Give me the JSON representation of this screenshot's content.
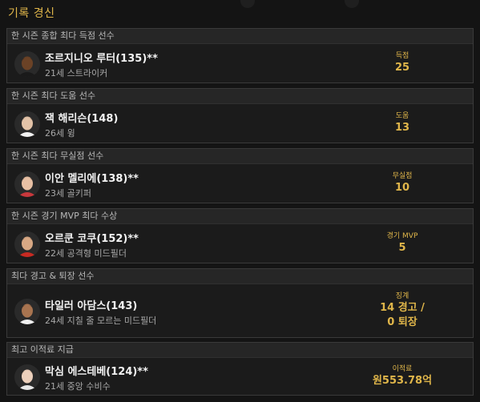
{
  "page_title": "기록 경신",
  "records": [
    {
      "category": "한 시즌 종합 최다 득점 선수",
      "name": "조르지니오 루터(135)**",
      "info": "21세 스트라이커",
      "stat_label": "득점",
      "stat_value": "25",
      "icon": "player-photo",
      "skin": "#6b4226",
      "hair": "#1a120c",
      "shirt": "#1a1a1a"
    },
    {
      "category": "한 시즌 최다 도움 선수",
      "name": "잭 해리슨(148)",
      "info": "26세 윙",
      "stat_label": "도움",
      "stat_value": "13",
      "icon": "player-photo",
      "skin": "#e3c3a8",
      "hair": "#3a2a1e",
      "shirt": "#f2f2f2"
    },
    {
      "category": "한 시즌 최다 무실점 선수",
      "name": "이안 멜리에(138)**",
      "info": "23세 골키퍼",
      "stat_label": "무실점",
      "stat_value": "10",
      "icon": "player-photo",
      "skin": "#e8c0a4",
      "hair": "#3a2a20",
      "shirt": "#c8383c"
    },
    {
      "category": "한 시즌 경기 MVP 최다 수상",
      "name": "오르쿤 코쿠(152)**",
      "info": "22세 공격형 미드필더",
      "stat_label": "경기 MVP",
      "stat_value": "5",
      "icon": "player-photo",
      "skin": "#d8a884",
      "hair": "#2a1e16",
      "shirt": "#c82a22"
    },
    {
      "category": "최다 경고 & 퇴장 선수",
      "name": "타일러 아담스(143)",
      "info": "24세 지칠 줄 모르는 미드필더",
      "stat_label": "징계",
      "stat_value": "14 경고 /\n0 퇴장",
      "icon": "player-photo",
      "skin": "#a87450",
      "hair": "#1e140e",
      "shirt": "#f0f0f0"
    },
    {
      "category": "최고 이적료 지급",
      "name": "막심 에스테베(124)**",
      "info": "21세 중앙 수비수",
      "stat_label": "이적료",
      "stat_value": "원553.78억",
      "icon": "player-photo",
      "skin": "#ecd0bc",
      "hair": "#7a5a3a",
      "shirt": "#e8e8e8"
    }
  ]
}
